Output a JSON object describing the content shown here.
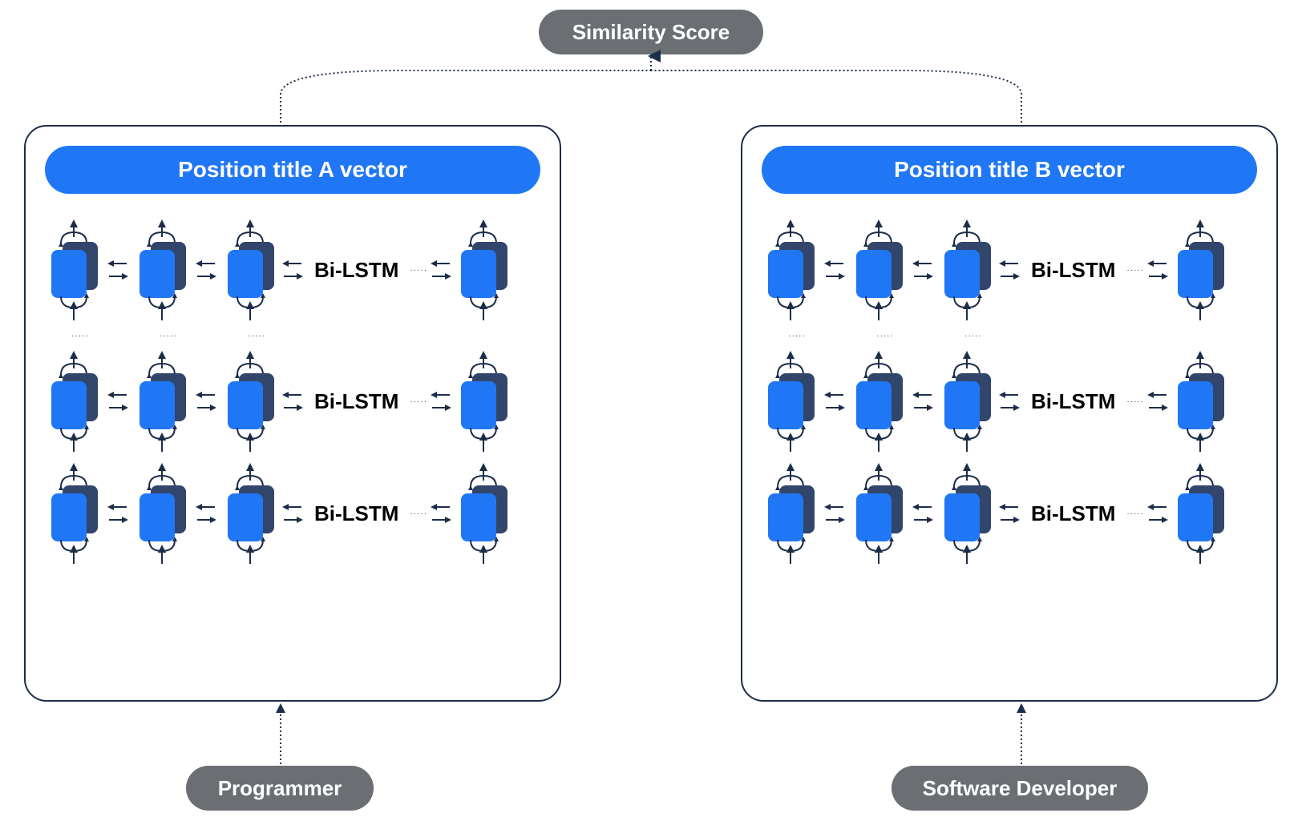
{
  "top": {
    "similarity_label": "Similarity Score"
  },
  "left": {
    "vector_label": "Position title A vector",
    "rows": [
      {
        "label": "Bi-LSTM"
      },
      {
        "label": "Bi-LSTM"
      },
      {
        "label": "Bi-LSTM"
      }
    ],
    "input_label": "Programmer"
  },
  "right": {
    "vector_label": "Position title B vector",
    "rows": [
      {
        "label": "Bi-LSTM"
      },
      {
        "label": "Bi-LSTM"
      },
      {
        "label": "Bi-LSTM"
      }
    ],
    "input_label": "Software Developer"
  },
  "colors": {
    "front": "#2077f6",
    "back": "#32456a",
    "line": "#1c2d4a",
    "gray": "#6b6f73"
  }
}
